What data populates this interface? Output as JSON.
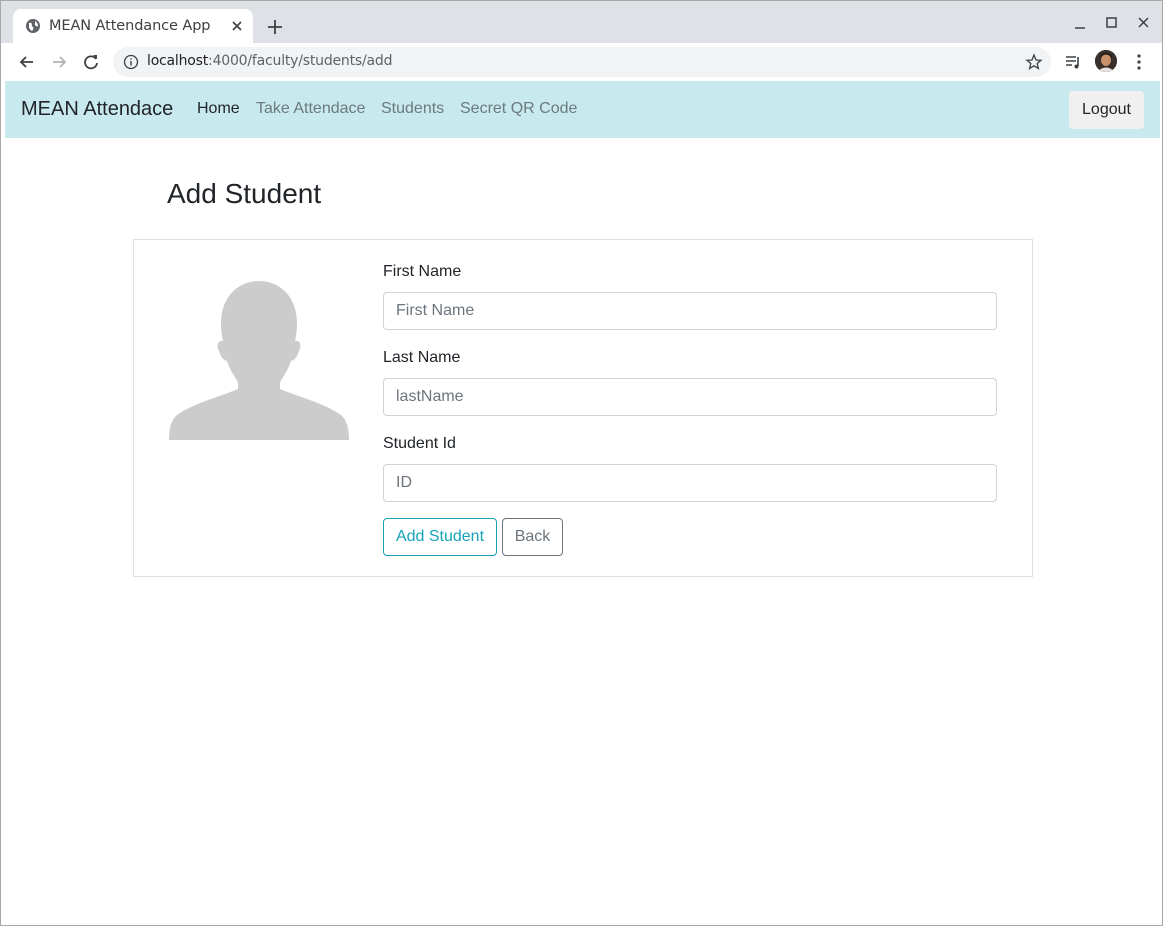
{
  "browser": {
    "tab_title": "MEAN Attendance App",
    "url_host": "localhost",
    "url_path": ":4000/faculty/students/add"
  },
  "navbar": {
    "brand": "MEAN Attendace",
    "links": [
      {
        "label": "Home",
        "active": true
      },
      {
        "label": "Take Attendace",
        "active": false
      },
      {
        "label": "Students",
        "active": false
      },
      {
        "label": "Secret QR Code",
        "active": false
      }
    ],
    "logout_label": "Logout"
  },
  "page": {
    "title": "Add Student"
  },
  "form": {
    "first_name": {
      "label": "First Name",
      "placeholder": "First Name",
      "value": ""
    },
    "last_name": {
      "label": "Last Name",
      "placeholder": "lastName",
      "value": ""
    },
    "student_id": {
      "label": "Student Id",
      "placeholder": "ID",
      "value": ""
    },
    "add_label": "Add Student",
    "back_label": "Back"
  },
  "colors": {
    "navbar_bg": "#c8e9ee",
    "accent_info": "#17a2b8",
    "secondary": "#6c757d",
    "avatar_fill": "#cccccc"
  },
  "icons": [
    "globe-icon",
    "close-icon",
    "plus-icon",
    "minimize-icon",
    "maximize-icon",
    "back-arrow-icon",
    "forward-arrow-icon",
    "reload-icon",
    "info-icon",
    "star-icon",
    "media-control-icon",
    "profile-avatar",
    "menu-kebab-icon",
    "avatar-placeholder-icon"
  ]
}
